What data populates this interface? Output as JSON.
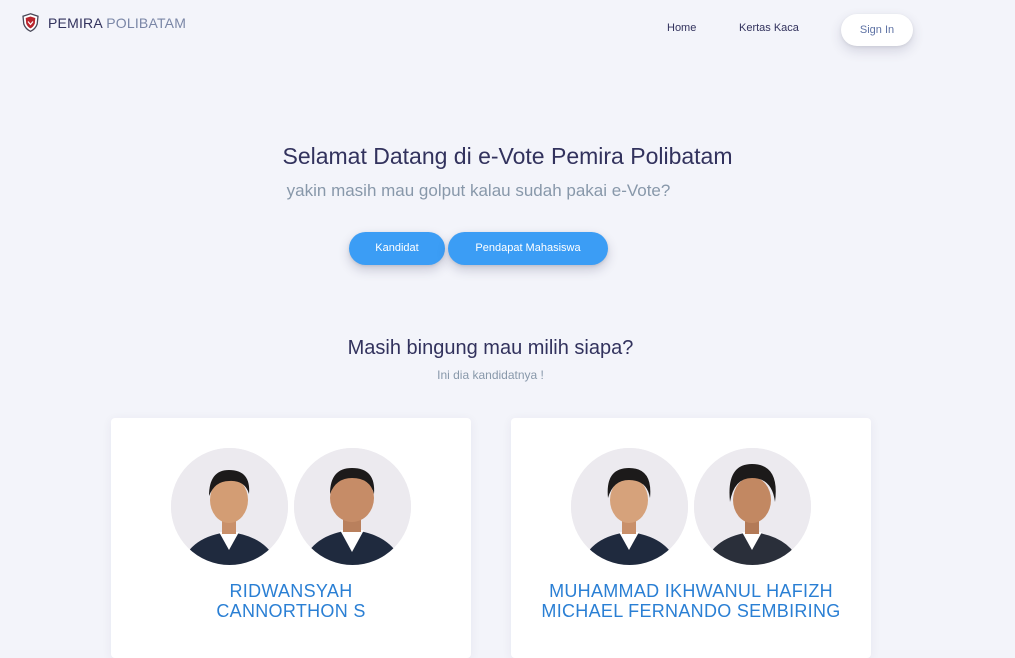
{
  "navbar": {
    "brand_primary": "PEMIRA",
    "brand_secondary": "POLIBATAM",
    "links": [
      {
        "label": "Home"
      },
      {
        "label": "Kertas Kaca"
      }
    ],
    "sign_in_label": "Sign In"
  },
  "hero": {
    "title": "Selamat Datang di e-Vote Pemira Polibatam",
    "subtitle": "yakin masih mau golput kalau sudah pakai e-Vote?",
    "buttons": {
      "kandidat": "Kandidat",
      "pendapat": "Pendapat Mahasiswa"
    }
  },
  "candidates_section": {
    "title": "Masih bingung mau milih siapa?",
    "subtitle": "Ini dia kandidatnya !",
    "cards": [
      {
        "names": [
          "RIDWANSYAH",
          "CANNORTHON S"
        ]
      },
      {
        "names": [
          "MUHAMMAD IKHWANUL HAFIZH",
          "MICHAEL FERNANDO SEMBIRING"
        ]
      }
    ]
  },
  "colors": {
    "background": "#f3f4fa",
    "primary_button": "#3b9df5",
    "candidate_name": "#2a7fd4",
    "heading": "#32325d",
    "muted": "#8898aa"
  },
  "icons": {
    "brand_logo": "shield-logo-icon"
  }
}
